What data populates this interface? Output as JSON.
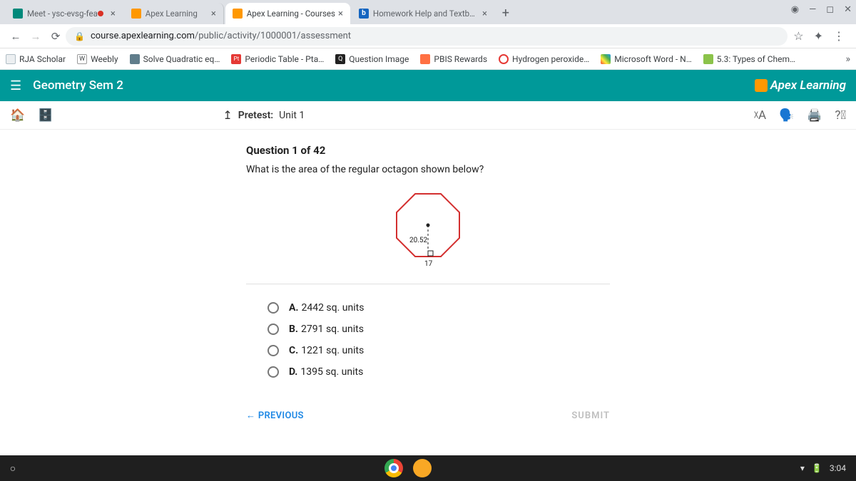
{
  "tabs": [
    {
      "title": "Meet - ysc-evsg-fea",
      "active": false,
      "recording": true
    },
    {
      "title": "Apex Learning",
      "active": false
    },
    {
      "title": "Apex Learning - Courses",
      "active": true
    },
    {
      "title": "Homework Help and Textbook S",
      "active": false
    }
  ],
  "address": {
    "host": "course.apexlearning.com",
    "path": "/public/activity/1000001/assessment"
  },
  "bookmarks": [
    "RJA Scholar",
    "Weebly",
    "Solve Quadratic eq…",
    "Periodic Table - Pta…",
    "Question Image",
    "PBIS Rewards",
    "Hydrogen peroxide…",
    "Microsoft Word - N…",
    "5.3: Types of Chem…"
  ],
  "apex": {
    "course": "Geometry Sem 2",
    "brand": "Apex Learning",
    "breadcrumb_label": "Pretest:",
    "breadcrumb_unit": "Unit 1"
  },
  "question": {
    "header": "Question 1 of 42",
    "prompt": "What is the area of the regular octagon shown below?",
    "apothem": "20.52",
    "side": "17",
    "options": {
      "A": "2442 sq. units",
      "B": "2791 sq. units",
      "C": "1221 sq. units",
      "D": "1395 sq. units"
    },
    "prev": "PREVIOUS",
    "submit": "SUBMIT"
  },
  "clock": "3:04"
}
